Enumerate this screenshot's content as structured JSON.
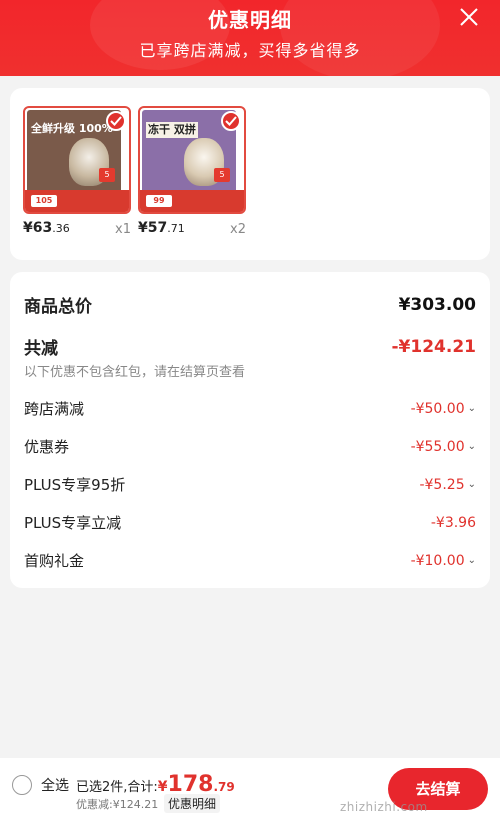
{
  "header": {
    "title": "优惠明细",
    "subtitle": "已享跨店满减，买得多省得多",
    "close_icon": "close-icon"
  },
  "products": [
    {
      "image_text": "全鲜升级 100%",
      "image_price": "105",
      "badge": "5",
      "price_int": "¥63",
      "price_dec": ".36",
      "qty": "x1",
      "color": "#7a5a4a"
    },
    {
      "image_text": "冻干 双拼",
      "image_price": "99",
      "badge": "5",
      "price_int": "¥57",
      "price_dec": ".71",
      "qty": "x2",
      "color": "#8b6fa8"
    }
  ],
  "summary": {
    "total_label": "商品总价",
    "total_value": "¥303.00",
    "reduce_label": "共减",
    "reduce_value": "-¥124.21",
    "note": "以下优惠不包含红包，请在结算页查看",
    "items": [
      {
        "label": "跨店满减",
        "value": "-¥50.00",
        "has_chevron": true
      },
      {
        "label": "优惠券",
        "value": "-¥55.00",
        "has_chevron": true
      },
      {
        "label": "PLUS专享95折",
        "value": "-¥5.25",
        "has_chevron": true
      },
      {
        "label": "PLUS专享立减",
        "value": "-¥3.96",
        "has_chevron": false
      },
      {
        "label": "首购礼金",
        "value": "-¥10.00",
        "has_chevron": true
      }
    ]
  },
  "footer": {
    "select_all": "全选",
    "selected_text": "已选2件,合计:",
    "total_yen": "¥",
    "total_int": "178",
    "total_dec": ".79",
    "reduced_text": "优惠减:¥124.21",
    "detail_btn": "优惠明细",
    "checkout_btn": "去结算"
  },
  "watermark": "zhizhizhi.com",
  "colors": {
    "brand_red": "#e0322d",
    "header_red": "#f2262b"
  }
}
